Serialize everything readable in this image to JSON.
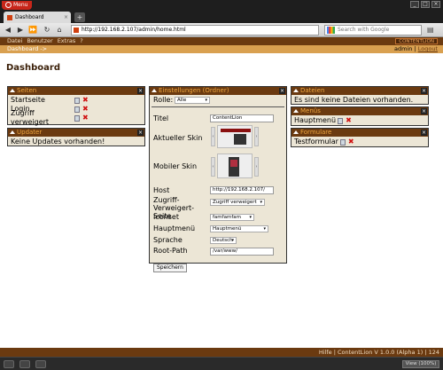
{
  "browser": {
    "menu_label": "Menu",
    "tab_title": "Dashboard",
    "tab_close": "×",
    "new_tab": "+",
    "url": "http://192.168.2.107/admin/home.html",
    "search_placeholder": "Search with Google",
    "zoom": "View (100%)"
  },
  "app": {
    "menu_items": [
      "Datei",
      "Benutzer",
      "Extras",
      "?"
    ],
    "logo": "CONTENTLION",
    "breadcrumb": "Dashboard ->",
    "user": "admin",
    "logout": "Logout"
  },
  "page": {
    "title": "Dashboard"
  },
  "seiten": {
    "title": "Seiten",
    "items": [
      {
        "label": "Startseite"
      },
      {
        "label": "Login"
      },
      {
        "label": "Zugriff verweigert"
      }
    ]
  },
  "updater": {
    "title": "Updater",
    "message": "Keine Updates vorhanden!"
  },
  "settings": {
    "title": "Einstellungen (Ordner)",
    "role_label": "Rolle:",
    "role_value": "Alle",
    "fields": {
      "titel_label": "Titel",
      "titel_value": "ContentLion",
      "skin_label": "Aktueller Skin",
      "mobile_label": "Mobiler Skin",
      "host_label": "Host",
      "host_value": "http://192.168.2.107/",
      "zugriff_label": "Zugriff-Verweigert-Seite",
      "zugriff_value": "Zugriff verweigert",
      "iconset_label": "Iconset",
      "iconset_value": "famfamfam",
      "haupt_label": "Hauptmenü",
      "haupt_value": "Hauptmenü",
      "sprache_label": "Sprache",
      "sprache_value": "Deutsch",
      "root_label": "Root-Path",
      "root_value": "/var/www/"
    },
    "save": "Speichern"
  },
  "dateien": {
    "title": "Dateien",
    "message": "Es sind keine Dateien vorhanden."
  },
  "menues": {
    "title": "Menüs",
    "items": [
      {
        "label": "Hauptmenü"
      }
    ]
  },
  "formulare": {
    "title": "Formulare",
    "items": [
      {
        "label": "Testformular"
      }
    ]
  },
  "footer": {
    "text": "Hilfe | ContentLion V 1.0.0 (Alpha 1) | 124"
  },
  "colors": {
    "brown": "#6b3a10",
    "orange": "#d9a050",
    "panel_bg": "#ece6d6"
  }
}
